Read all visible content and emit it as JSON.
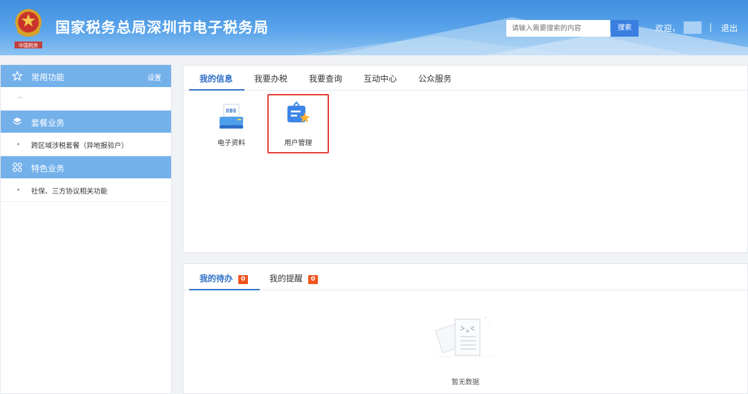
{
  "header": {
    "title": "国家税务总局深圳市电子税务局",
    "search_placeholder": "请输入需要搜索的内容",
    "search_button": "搜索",
    "welcome": "欢迎，",
    "separator": "|",
    "logout": "退出",
    "emblem_caption": "中国税务"
  },
  "sidebar": {
    "sections": [
      {
        "title": "常用功能",
        "action": "设置",
        "icon": "star-icon",
        "items": [
          "--"
        ]
      },
      {
        "title": "套餐业务",
        "icon": "layers-icon",
        "items": [
          "跨区域涉税套餐（异地报验户）"
        ]
      },
      {
        "title": "特色业务",
        "icon": "grid-icon",
        "items": [
          "社保、三方协议相关功能"
        ]
      }
    ]
  },
  "main_tabs": [
    {
      "label": "我的信息",
      "active": true
    },
    {
      "label": "我要办税",
      "active": false
    },
    {
      "label": "我要查询",
      "active": false
    },
    {
      "label": "互动中心",
      "active": false
    },
    {
      "label": "公众服务",
      "active": false
    }
  ],
  "apps": [
    {
      "label": "电子资料",
      "icon": "scanner-icon",
      "selected": false
    },
    {
      "label": "用户管理",
      "icon": "user-management-icon",
      "selected": true
    }
  ],
  "todo_tabs": [
    {
      "label": "我的待办",
      "count": "0",
      "active": true
    },
    {
      "label": "我的提醒",
      "count": "0",
      "active": false
    }
  ],
  "empty_state": {
    "text": "暂无数据",
    "icon": "empty-document-icon"
  },
  "colors": {
    "header_blue": "#4a97e4",
    "sidebar_head": "#74b1eb",
    "active_tab": "#2f6fc8",
    "badge": "#f0541d",
    "selection_border": "#e53935"
  }
}
